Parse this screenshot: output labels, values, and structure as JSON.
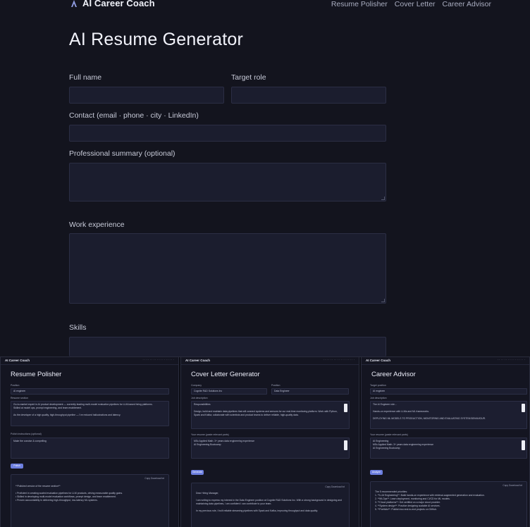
{
  "app": {
    "brand": "AI Career Coach",
    "nav_links": [
      "Resume Polisher",
      "Cover Letter",
      "Career Advisor"
    ]
  },
  "page": {
    "title": "AI Resume Generator",
    "fields": {
      "full_name": {
        "label": "Full name",
        "value": ""
      },
      "target_role": {
        "label": "Target role",
        "value": ""
      },
      "contact": {
        "label": "Contact (email · phone · city · LinkedIn)",
        "value": ""
      },
      "summary": {
        "label": "Professional summary (optional)",
        "value": ""
      },
      "work": {
        "label": "Work experience",
        "value": ""
      },
      "skills": {
        "label": "Skills",
        "value": ""
      }
    }
  },
  "thumbnails": [
    {
      "brand": "AI Career Coach",
      "title": "Resume Polisher",
      "label1": "Position",
      "value1": "AI engineer",
      "label2": "Resume section",
      "text2": "Go-to-market expert in AI product development — currently leading multi-model evaluation pipelines for LLM-based hiring platforms.\nSkilled at model ops, prompt engineering, and team enablement.\n\nAs the developer of a high quality, high-throughput pipeline — I've reduced hallucinations and latency.",
      "label3": "Polish instructions (optional)",
      "text3": "Make the concise & compelling",
      "button": "Polish",
      "out_bar": "Copy   Download txt",
      "out_text": "**Polished version of the resume section**\n\n• Proficient in creating scaled evaluation pipelines for LLM products, driving measurable quality gains.\n• Skilled in developing multi-model evaluation workflows, prompt design, and team enablement.\n• Proven accountability in delivering high-throughput, low-latency ML systems."
    },
    {
      "brand": "AI Career Coach",
      "title": "Cover Letter Generator",
      "label1a": "Company",
      "value1a": "Cognite R&D Solutions Inc",
      "label1b": "Position",
      "value1b": "Data Engineer",
      "label2": "Job description",
      "text2": "Responsibilities\n\nDesign, build and maintain data pipelines that will connect systems and sensors for our real-time monitoring platform. Work with Python, Spark and Kafka; collaborate with scientists and product teams to deliver reliable, high-quality data.",
      "label3": "Your resume (paste relevant parts)",
      "text3": "MSc Applied Math. 3+ years data engineering experience\nAI Engineering Bootcamp",
      "button": "Generate",
      "out_bar": "Copy   Download txt",
      "out_text": "Dear Hiring Manager,\n\nI am writing to express my interest in the Data Engineer position at Cognite R&D Solutions Inc. With a strong background in designing and maintaining data pipelines, I am confident I can contribute to your team.\n\nIn my previous role, I built reliable streaming pipelines with Spark and Kafka, improving throughput and data quality."
    },
    {
      "brand": "AI Career Coach",
      "title": "Career Advisor",
      "label1": "Target position",
      "value1": "AI engineer",
      "label2": "Job description",
      "text2": "The AI Engineer role...\n\nHands-on experience with LLMs and ML frameworks.\n\nDEPLOYING ML MODELS TO PRODUCTION, MONITORING AND EVALUATING SYSTEM BEHAVIOUR.",
      "label3": "Your resume (paste relevant parts)",
      "text3": "AI Engineering\nMSc Applied Math. 3+ years data engineering experience\nAI Engineering Bootcamp",
      "button": "Analyze",
      "out_bar": "Copy   Download txt",
      "out_text": "The 5 recommended priorities:\n1. **LLM Engineering**: Build hands-on experience with retrieval-augmented generation and evaluation.\n2. **MLOps**: Learn deployment, monitoring and CI/CD for ML models.\n3. **Cloud platforms**: Get certified on a major cloud provider.\n4. **System design**: Practice designing scalable AI services.\n5. **Portfolio**: Publish two end-to-end projects on GitHub."
    }
  ]
}
